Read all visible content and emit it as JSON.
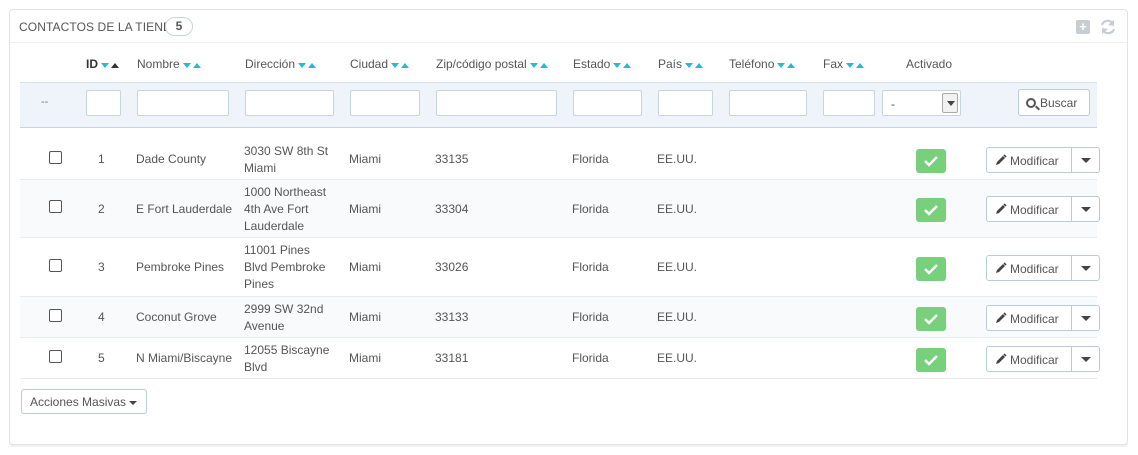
{
  "panel": {
    "title": "Contactos de la tienda",
    "count": "5"
  },
  "columns": {
    "id": "ID",
    "nombre": "Nombre",
    "direccion": "Dirección",
    "ciudad": "Ciudad",
    "zip": "Zip/código postal",
    "estado": "Estado",
    "pais": "País",
    "telefono": "Teléfono",
    "fax": "Fax",
    "activado": "Activado"
  },
  "filters": {
    "placeholder_dash": "--",
    "activado_selected": "-",
    "search_label": "Buscar"
  },
  "rows": [
    {
      "id": "1",
      "nombre": "Dade County",
      "direccion": "3030 SW 8th St Miami",
      "ciudad": "Miami",
      "zip": "33135",
      "estado": "Florida",
      "pais": "EE.UU.",
      "telefono": "",
      "fax": "",
      "activado": true,
      "edit_label": "Modificar"
    },
    {
      "id": "2",
      "nombre": "E Fort Lauderdale",
      "direccion": "1000 Northeast 4th Ave Fort Lauderdale",
      "ciudad": "Miami",
      "zip": "33304",
      "estado": "Florida",
      "pais": "EE.UU.",
      "telefono": "",
      "fax": "",
      "activado": true,
      "edit_label": "Modificar"
    },
    {
      "id": "3",
      "nombre": "Pembroke Pines",
      "direccion": "11001 Pines Blvd Pembroke Pines",
      "ciudad": "Miami",
      "zip": "33026",
      "estado": "Florida",
      "pais": "EE.UU.",
      "telefono": "",
      "fax": "",
      "activado": true,
      "edit_label": "Modificar"
    },
    {
      "id": "4",
      "nombre": "Coconut Grove",
      "direccion": "2999 SW 32nd Avenue",
      "ciudad": "Miami",
      "zip": "33133",
      "estado": "Florida",
      "pais": "EE.UU.",
      "telefono": "",
      "fax": "",
      "activado": true,
      "edit_label": "Modificar"
    },
    {
      "id": "5",
      "nombre": "N Miami/Biscayne",
      "direccion": "12055 Biscayne Blvd",
      "ciudad": "Miami",
      "zip": "33181",
      "estado": "Florida",
      "pais": "EE.UU.",
      "telefono": "",
      "fax": "",
      "activado": true,
      "edit_label": "Modificar"
    }
  ],
  "footer": {
    "bulk_actions_label": "Acciones Masivas"
  },
  "colors": {
    "accent": "#25b9d7",
    "active_green": "#78d07d"
  },
  "icons": {
    "add": "plus-square-icon",
    "refresh": "refresh-icon",
    "search": "search-icon",
    "edit": "pencil-icon",
    "active": "check-icon"
  }
}
